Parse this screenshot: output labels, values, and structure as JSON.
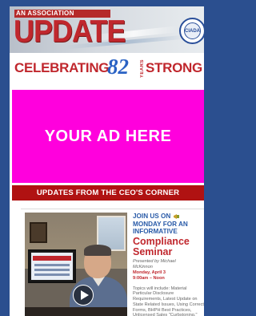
{
  "header": {
    "kicker": "AN ASSOCIATION",
    "masthead": "UPDATE",
    "seal_label": "CIADA",
    "colors": {
      "red": "#c0272d",
      "blue": "#2a4f9a"
    }
  },
  "celebrating": {
    "left_text": "CELEBRATING",
    "number": "82",
    "years_word": "YEARS",
    "right_text": "STRONG"
  },
  "ad": {
    "text": "YOUR AD HERE",
    "color": "#ff00dd"
  },
  "section": {
    "heading": "UPDATES FROM THE CEO'S CORNER"
  },
  "article": {
    "join_line_1": "JOIN US ON",
    "join_line_2": "MONDAY FOR AN",
    "join_line_3": "INFORMATIVE",
    "megaphone_icon": "megaphone-icon",
    "headline_1": "Compliance",
    "headline_2": "Seminar",
    "presented_by": "Presented by Michael",
    "presenter": "McKinnon",
    "date": "Monday, April 3",
    "time": "9:00am – Noon",
    "topics": "Topics will include: Material Particular Disclosure Requirements, Latest Update on State Related Issues, Using Correct Forms, BHPH Best Practices, Unlicensed Sales \"Curbstoning,\"",
    "video_icon": "play-icon"
  }
}
